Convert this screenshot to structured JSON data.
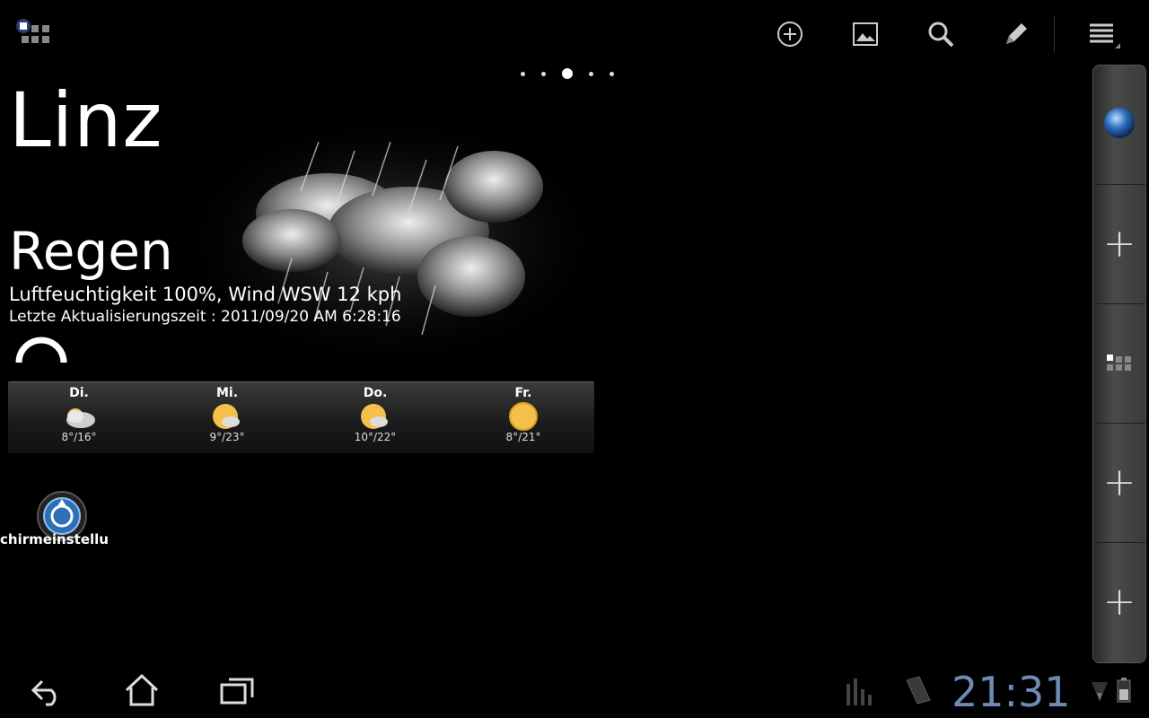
{
  "weather": {
    "city": "Linz",
    "condition": "Regen",
    "details": "Luftfeuchtigkeit 100%, Wind WSW 12 kph",
    "updated": "Letzte Aktualisierungszeit : 2011/09/20 AM 6:28:16",
    "forecast": [
      {
        "day": "Di.",
        "temp": "8°/16°",
        "icon": "cloudy-icon"
      },
      {
        "day": "Mi.",
        "temp": "9°/23°",
        "icon": "partly-cloudy-icon"
      },
      {
        "day": "Do.",
        "temp": "10°/22°",
        "icon": "partly-cloudy-icon"
      },
      {
        "day": "Fr.",
        "temp": "8°/21°",
        "icon": "sunny-icon"
      }
    ]
  },
  "app_shortcut": {
    "label": "chirmeinstellu"
  },
  "status_bar": {
    "time": "21:31"
  },
  "pager": {
    "count": 5,
    "active": 2
  },
  "colors": {
    "clock": "#6f8bb3",
    "accent": "#4a8ed8"
  }
}
